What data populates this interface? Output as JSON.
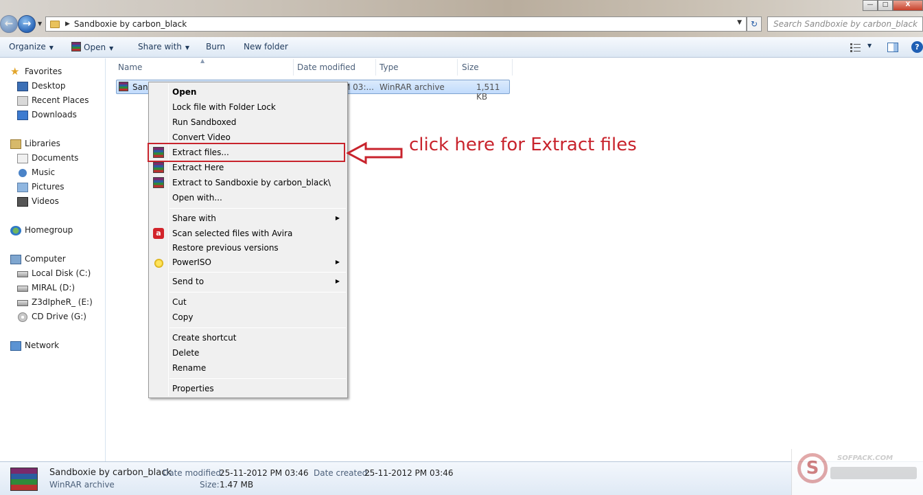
{
  "window": {
    "controls": [
      "—",
      "□",
      "X"
    ]
  },
  "address_bar": {
    "path": "Sandboxie by carbon_black"
  },
  "search": {
    "placeholder": "Search Sandboxie by carbon_black"
  },
  "toolbar": {
    "organize": "Organize",
    "open": "Open",
    "share_with": "Share with",
    "burn": "Burn",
    "new_folder": "New folder"
  },
  "nav": {
    "favorites": {
      "title": "Favorites",
      "items": [
        "Desktop",
        "Recent Places",
        "Downloads"
      ]
    },
    "libraries": {
      "title": "Libraries",
      "items": [
        "Documents",
        "Music",
        "Pictures",
        "Videos"
      ]
    },
    "homegroup": "Homegroup",
    "computer": {
      "title": "Computer",
      "items": [
        "Local Disk (C:)",
        "MIRAL (D:)",
        "Z3dIpheR_ (E:)",
        "CD Drive (G:)"
      ]
    },
    "network": "Network"
  },
  "file_list": {
    "columns": [
      "Name",
      "Date modified",
      "Type",
      "Size"
    ],
    "rows": [
      {
        "name": "Sand",
        "date_modified": "M 03:...",
        "type": "WinRAR archive",
        "size": "1,511 KB"
      }
    ]
  },
  "context_menu": {
    "items": [
      "Open",
      "Lock file with Folder Lock",
      "Run Sandboxed",
      "Convert Video",
      "Extract files...",
      "Extract Here",
      "Extract to Sandboxie by carbon_black\\",
      "Open with...",
      "Share with",
      "Scan selected files with Avira",
      "Restore previous versions",
      "PowerISO",
      "Send to",
      "Cut",
      "Copy",
      "Create shortcut",
      "Delete",
      "Rename",
      "Properties"
    ],
    "avira_glyph": "a"
  },
  "annotation": {
    "text": "click here for Extract files",
    "color": "#c8232c"
  },
  "details": {
    "name": "Sandboxie by carbon_black",
    "type": "WinRAR archive",
    "date_modified_label": "Date modified:",
    "date_modified": "25-11-2012 PM 03:46",
    "date_created_label": "Date created:",
    "date_created": "25-11-2012 PM 03:46",
    "size_label": "Size:",
    "size": "1.47 MB"
  },
  "watermark": {
    "text": "SOFPACK.COM",
    "glyph": "S"
  },
  "help_glyph": "?"
}
